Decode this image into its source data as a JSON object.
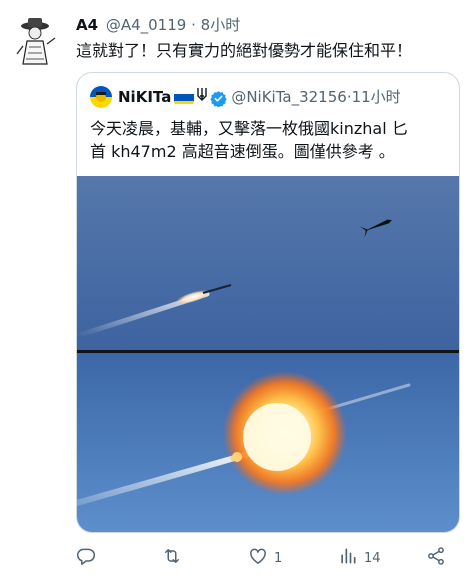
{
  "tweet": {
    "author_name": "A4",
    "author_handle": "@A4_0119",
    "separator": "·",
    "time": "8小时",
    "text": "這就對了！只有實力的絕對優勢才能保住和平！"
  },
  "quoted": {
    "author_name": "NiKITa",
    "author_handle": "@NiKiTa_32156",
    "separator": "·",
    "time": "11小时",
    "text_lines": [
      "今天凌晨，基輔，又擊落一枚俄國kinzhal 匕",
      "首 kh47m2 高超音速倒蛋。圖僅供參考 。"
    ]
  },
  "actions": {
    "reply_count": "",
    "retweet_count": "",
    "like_count": "1",
    "views_count": "14",
    "share_count": ""
  },
  "icons": {
    "reply": "reply-icon",
    "retweet": "retweet-icon",
    "like": "heart-icon",
    "views": "views-icon",
    "share": "share-icon",
    "verified": "verified-badge-icon",
    "flag": "ukraine-flag-icon",
    "trident": "trident-icon"
  },
  "colors": {
    "text_primary": "#0f1419",
    "text_secondary": "#536471",
    "border": "#cfd9de",
    "verified_blue": "#1d9bf0",
    "flag_blue": "#0057b7",
    "flag_yellow": "#ffd700"
  }
}
